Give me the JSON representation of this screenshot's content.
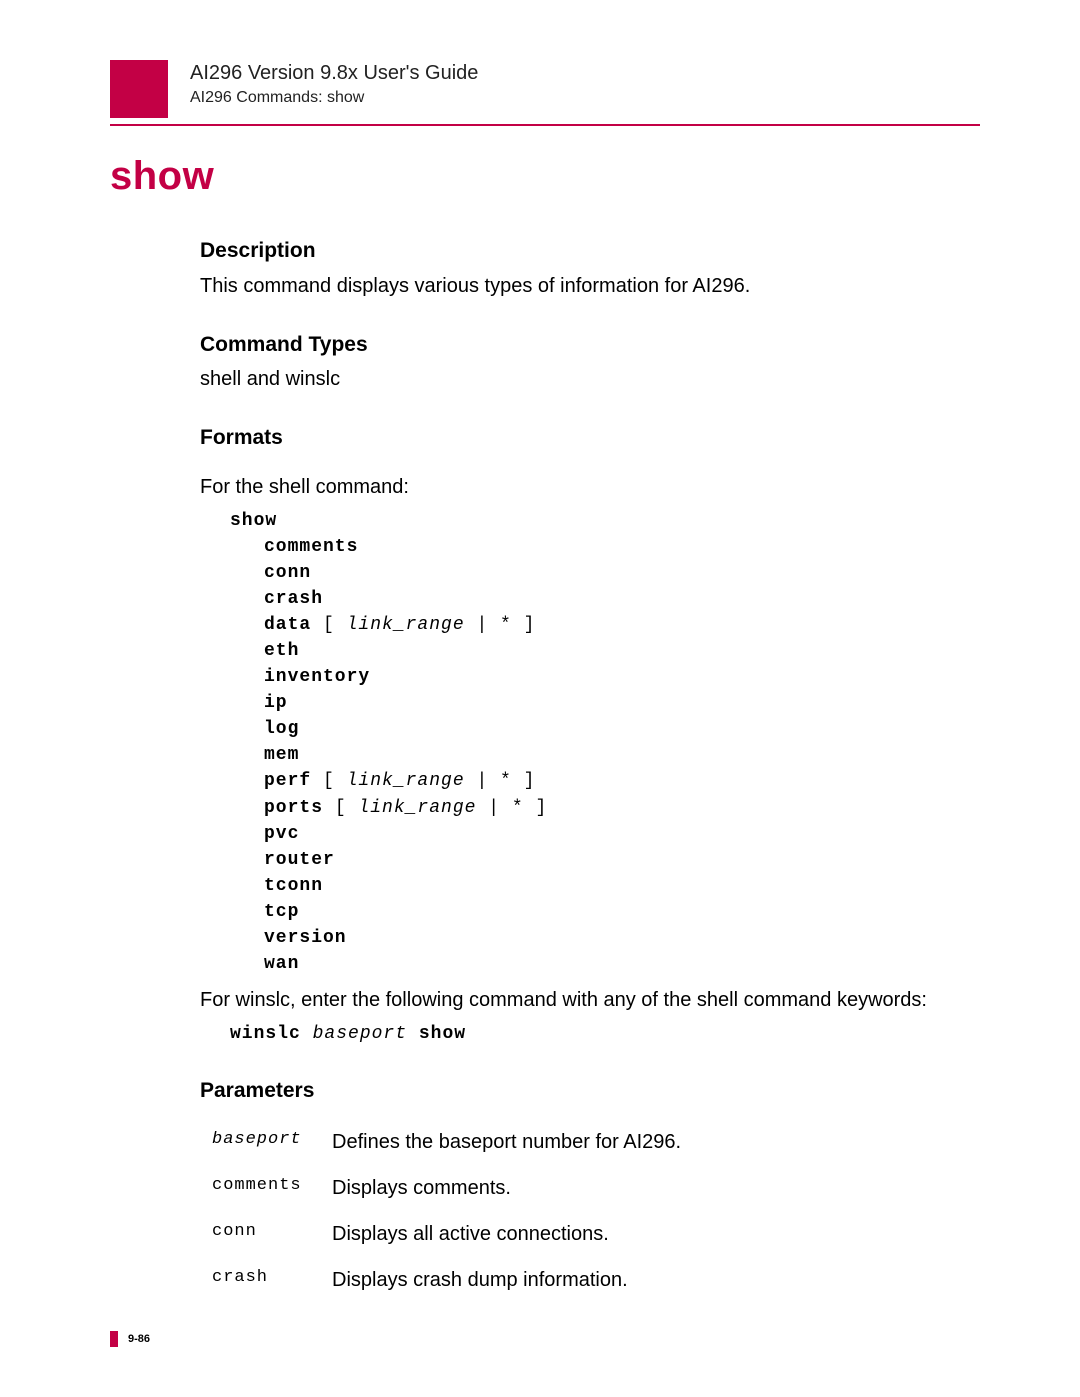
{
  "header": {
    "guide_title": "AI296 Version 9.8x User's Guide",
    "breadcrumb": "AI296 Commands: show"
  },
  "title": "show",
  "sections": {
    "description": {
      "heading": "Description",
      "body": "This command displays various types of information for AI296."
    },
    "command_types": {
      "heading": "Command Types",
      "body": "shell and winslc"
    },
    "formats": {
      "heading": "Formats",
      "intro": "For the shell command:",
      "cmd_root": "show",
      "items": {
        "comments": "comments",
        "conn": "conn",
        "crash": "crash",
        "data_kw": "data",
        "data_arg": "link_range",
        "data_tail": " | * ]",
        "data_open": " [ ",
        "eth": "eth",
        "inventory": "inventory",
        "ip": "ip",
        "log": "log",
        "mem": "mem",
        "perf_kw": "perf",
        "perf_arg": "link_range",
        "ports_kw": "ports",
        "ports_arg": "link_range",
        "bracket_open": " [ ",
        "bracket_tail": " | * ]",
        "pvc": "pvc",
        "router": "router",
        "tconn": "tconn",
        "tcp": "tcp",
        "version": "version",
        "wan": "wan"
      },
      "winslc_intro": "For winslc, enter the following command with any of the shell command keywords:",
      "winslc_cmd_a": "winslc ",
      "winslc_cmd_b": "baseport",
      "winslc_cmd_c": " show"
    },
    "parameters": {
      "heading": "Parameters",
      "rows": [
        {
          "name": "baseport",
          "italic": true,
          "desc": "Defines the baseport number for AI296."
        },
        {
          "name": "comments",
          "italic": false,
          "desc": "Displays comments."
        },
        {
          "name": "conn",
          "italic": false,
          "desc": "Displays all active connections."
        },
        {
          "name": "crash",
          "italic": false,
          "desc": "Displays crash dump information."
        }
      ]
    }
  },
  "footer": {
    "page": "9-86"
  }
}
